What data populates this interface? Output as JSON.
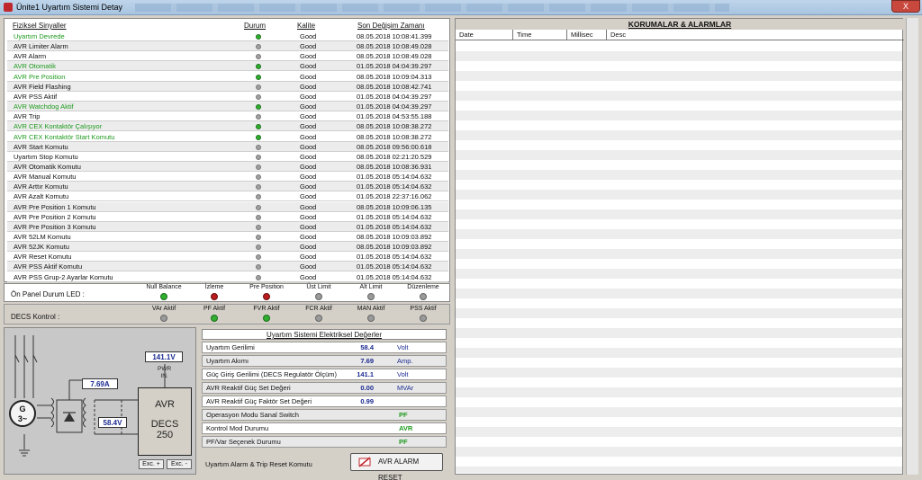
{
  "window": {
    "title": "Ünite1 Uyartım Sistemi Detay",
    "close": "X"
  },
  "signals": {
    "headers": {
      "name": "Fiziksel Sinyaller",
      "state": "Durum",
      "quality": "Kalite",
      "time": "Son Değişim Zamanı"
    },
    "rows": [
      {
        "name": "Uyartım Devrede",
        "on": true,
        "green": true,
        "quality": "Good",
        "time": "08.05.2018 10:08:41.399"
      },
      {
        "name": "AVR Limiter Alarm",
        "on": false,
        "green": false,
        "quality": "Good",
        "time": "08.05.2018 10:08:49.028"
      },
      {
        "name": "AVR Alarm",
        "on": false,
        "green": false,
        "quality": "Good",
        "time": "08.05.2018 10:08:49.028"
      },
      {
        "name": "AVR Otomatik",
        "on": true,
        "green": true,
        "quality": "Good",
        "time": "01.05.2018 04:04:39.297"
      },
      {
        "name": "AVR Pre Position",
        "on": true,
        "green": true,
        "quality": "Good",
        "time": "08.05.2018 10:09:04.313"
      },
      {
        "name": "AVR Field Flashing",
        "on": false,
        "green": false,
        "quality": "Good",
        "time": "08.05.2018 10:08:42.741"
      },
      {
        "name": "AVR PSS Aktif",
        "on": false,
        "green": false,
        "quality": "Good",
        "time": "01.05.2018 04:04:39.297"
      },
      {
        "name": "AVR Watchdog Aktif",
        "on": true,
        "green": true,
        "quality": "Good",
        "time": "01.05.2018 04:04:39.297"
      },
      {
        "name": "AVR Trip",
        "on": false,
        "green": false,
        "quality": "Good",
        "time": "01.05.2018 04:53:55.188"
      },
      {
        "name": "AVR CEX Kontaktör Çalışıyor",
        "on": true,
        "green": true,
        "quality": "Good",
        "time": "08.05.2018 10:08:38.272"
      },
      {
        "name": "AVR CEX Kontaktör Start Komutu",
        "on": true,
        "green": true,
        "quality": "Good",
        "time": "08.05.2018 10:08:38.272"
      },
      {
        "name": "AVR Start Komutu",
        "on": false,
        "green": false,
        "quality": "Good",
        "time": "08.05.2018 09:56:00.618"
      },
      {
        "name": "Uyartım Stop Komutu",
        "on": false,
        "green": false,
        "quality": "Good",
        "time": "08.05.2018 02:21:20.529"
      },
      {
        "name": "AVR Otomatik Komutu",
        "on": false,
        "green": false,
        "quality": "Good",
        "time": "08.05.2018 10:08:36.931"
      },
      {
        "name": "AVR Manual Komutu",
        "on": false,
        "green": false,
        "quality": "Good",
        "time": "01.05.2018 05:14:04.632"
      },
      {
        "name": "AVR Arttır Komutu",
        "on": false,
        "green": false,
        "quality": "Good",
        "time": "01.05.2018 05:14:04.632"
      },
      {
        "name": "AVR Azalt Komutu",
        "on": false,
        "green": false,
        "quality": "Good",
        "time": "01.05.2018 22:37:16.062"
      },
      {
        "name": "AVR Pre Position 1 Komutu",
        "on": false,
        "green": false,
        "quality": "Good",
        "time": "08.05.2018 10:09:06.135"
      },
      {
        "name": "AVR Pre Position 2 Komutu",
        "on": false,
        "green": false,
        "quality": "Good",
        "time": "01.05.2018 05:14:04.632"
      },
      {
        "name": "AVR Pre Position 3 Komutu",
        "on": false,
        "green": false,
        "quality": "Good",
        "time": "01.05.2018 05:14:04.632"
      },
      {
        "name": "AVR 52LM Komutu",
        "on": false,
        "green": false,
        "quality": "Good",
        "time": "08.05.2018 10:09:03.892"
      },
      {
        "name": "AVR 52JK Komutu",
        "on": false,
        "green": false,
        "quality": "Good",
        "time": "08.05.2018 10:09:03.892"
      },
      {
        "name": "AVR Reset Komutu",
        "on": false,
        "green": false,
        "quality": "Good",
        "time": "01.05.2018 05:14:04.632"
      },
      {
        "name": "AVR PSS Aktif Komutu",
        "on": false,
        "green": false,
        "quality": "Good",
        "time": "01.05.2018 05:14:04.632"
      },
      {
        "name": "AVR PSS Grup-2 Ayarlar Komutu",
        "on": false,
        "green": false,
        "quality": "Good",
        "time": "01.05.2018 05:14:04.632"
      }
    ]
  },
  "front_panel": {
    "label": "Ön Panel Durum LED :",
    "leds": [
      {
        "label": "Null Balance",
        "state": "green"
      },
      {
        "label": "İzleme",
        "state": "red"
      },
      {
        "label": "Pre Position",
        "state": "red"
      },
      {
        "label": "Üst Limit",
        "state": "gray"
      },
      {
        "label": "Alt Limit",
        "state": "gray"
      },
      {
        "label": "Düzenleme",
        "state": "gray"
      }
    ]
  },
  "decs": {
    "label": "DECS Kontrol :",
    "leds": [
      {
        "label": "VAr Aktif",
        "state": "gray"
      },
      {
        "label": "PF Aktif",
        "state": "green"
      },
      {
        "label": "FVR Aktif",
        "state": "green"
      },
      {
        "label": "FCR Aktif",
        "state": "gray"
      },
      {
        "label": "MAN Aktif",
        "state": "gray"
      },
      {
        "label": "PSS Aktif",
        "state": "gray"
      }
    ]
  },
  "diagram": {
    "generator": "G",
    "generator_phase": "3~",
    "pwr_value": "141.1V",
    "pwr_label": "PWR",
    "pwr_in": "IN.",
    "field_current": "7.69A",
    "field_voltage": "58.4V",
    "avr_line1": "AVR",
    "avr_line2": "DECS",
    "avr_line3": "250",
    "exc_plus": "Exc. +",
    "exc_minus": "Exc. -"
  },
  "values": {
    "title": "Uyartım Sistemi Elektriksel Değerler",
    "rows": [
      {
        "label": "Uyartım Gerilimi",
        "value": "58.4",
        "unit": "Volt"
      },
      {
        "label": "Uyartım Akımı",
        "value": "7.69",
        "unit": "Amp."
      },
      {
        "label": "Güç Giriş Gerilimi (DECS Regulatör Ölçüm)",
        "value": "141.1",
        "unit": "Volt"
      },
      {
        "label": "AVR Reaktif Güç Set Değeri",
        "value": "0.00",
        "unit": "MVAr"
      },
      {
        "label": "AVR Reaktif Güç Faktör Set Değeri",
        "value": "0.99",
        "unit": ""
      }
    ],
    "states": [
      {
        "label": "Operasyon Modu Sanal Switch",
        "state": "PF"
      },
      {
        "label": "Kontrol Mod Durumu",
        "state": "AVR"
      },
      {
        "label": "PF/Var Seçenek Durumu",
        "state": "PF"
      }
    ],
    "reset_label": "Uyartım Alarm & Trip Reset Komutu",
    "reset_button": "AVR ALARM RESET"
  },
  "alarms": {
    "title": "KORUMALAR & ALARMLAR",
    "columns": [
      "Date",
      "Time",
      "Millisec",
      "Desc"
    ]
  },
  "colors": {
    "accent_green": "#1e9a1e",
    "value_blue": "#1a2a90",
    "alarm_red": "#b91c1c"
  }
}
